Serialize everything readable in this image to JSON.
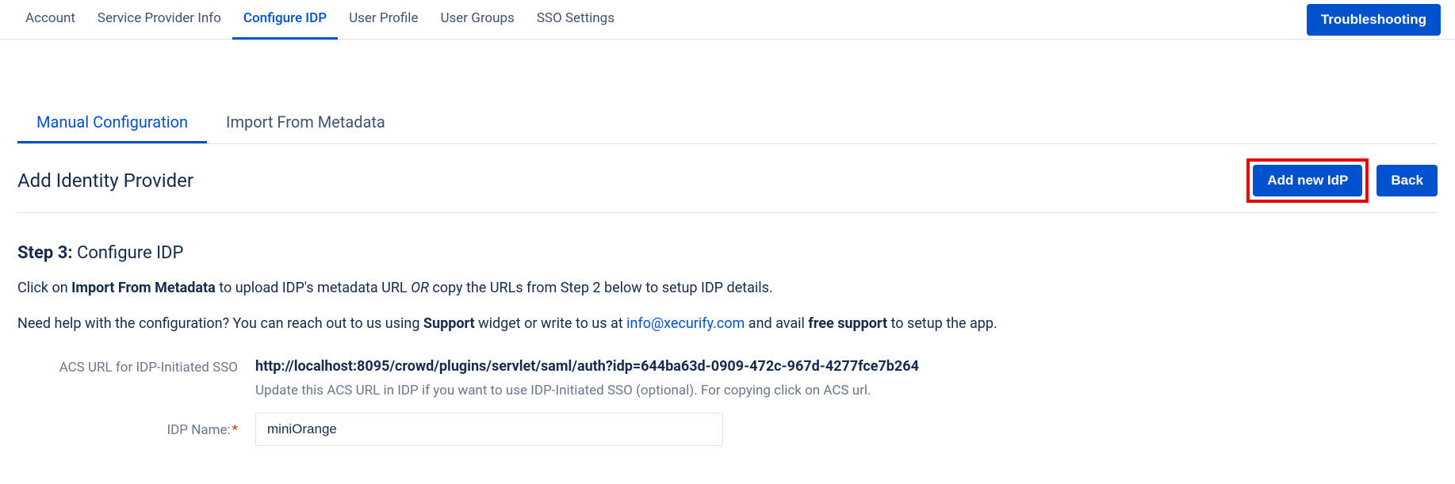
{
  "topnav": {
    "tabs": [
      {
        "label": "Account"
      },
      {
        "label": "Service Provider Info"
      },
      {
        "label": "Configure IDP"
      },
      {
        "label": "User Profile"
      },
      {
        "label": "User Groups"
      },
      {
        "label": "SSO Settings"
      }
    ],
    "troubleshooting": "Troubleshooting"
  },
  "subtabs": {
    "manual": "Manual Configuration",
    "import": "Import From Metadata"
  },
  "heading": {
    "title": "Add Identity Provider",
    "add_btn": "Add new IdP",
    "back_btn": "Back"
  },
  "step": {
    "prefix": "Step 3:",
    "text": " Configure IDP"
  },
  "para1": {
    "t1": "Click on ",
    "b1": "Import From Metadata",
    "t2": " to upload IDP's metadata URL ",
    "i1": "OR",
    "t3": " copy the URLs from Step 2 below to setup IDP details."
  },
  "para2": {
    "t1": "Need help with the configuration? You can reach out to us using ",
    "b1": "Support",
    "t2": " widget or write to us at ",
    "link": "info@xecurify.com",
    "t3": " and avail ",
    "b2": "free support",
    "t4": " to setup the app."
  },
  "form": {
    "acs_label": "ACS URL for IDP-Initiated SSO",
    "acs_value": "http://localhost:8095/crowd/plugins/servlet/saml/auth?idp=644ba63d-0909-472c-967d-4277fce7b264",
    "acs_help": "Update this ACS URL in IDP if you want to use IDP-Initiated SSO (optional). For copying click on ACS url.",
    "idp_name_label": "IDP Name:",
    "idp_name_value": "miniOrange"
  }
}
